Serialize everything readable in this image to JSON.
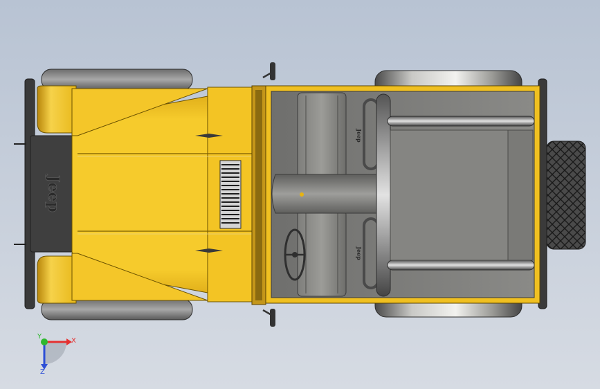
{
  "viewport": {
    "background_top": "#b8c3d3",
    "background_bottom": "#d6dbe3"
  },
  "model": {
    "grille_text": "Jeep",
    "side_badge_text": "Jeep",
    "body_color": "#f2c21d",
    "body_shadow_color": "#b8860b",
    "chrome_color": "#c4c4c4",
    "interior_color": "#7b7b79",
    "tire_color": "#3b3b3b"
  },
  "triad": {
    "x_label": "X",
    "y_label": "Y",
    "z_label": "Z",
    "x_color": "#e53030",
    "y_color": "#2eb82e",
    "z_color": "#2d4fd6"
  }
}
